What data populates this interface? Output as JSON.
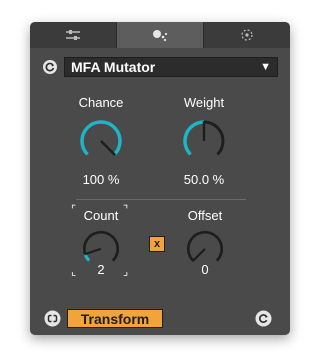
{
  "device": {
    "name": "MFA Mutator",
    "dropdown_glyph": "▼"
  },
  "tabs": [
    {
      "icon": "sliders-icon",
      "active": false
    },
    {
      "icon": "dice-icon",
      "active": true
    },
    {
      "icon": "target-icon",
      "active": false
    }
  ],
  "knobs": {
    "chance": {
      "label": "Chance",
      "value": "100 %",
      "fraction": 1.0
    },
    "weight": {
      "label": "Weight",
      "value": "50.0 %",
      "fraction": 0.5
    },
    "count": {
      "label": "Count",
      "value": "2",
      "fraction": 0.1
    },
    "offset": {
      "label": "Offset",
      "value": "0",
      "fraction": 0.0
    }
  },
  "toggle": {
    "label": "x"
  },
  "bottom": {
    "transform_label": "Transform"
  },
  "colors": {
    "accent": "#1fb5c7",
    "highlight": "#f2a33a",
    "panel": "#4a4a4a",
    "track": "#1e1e1e"
  }
}
